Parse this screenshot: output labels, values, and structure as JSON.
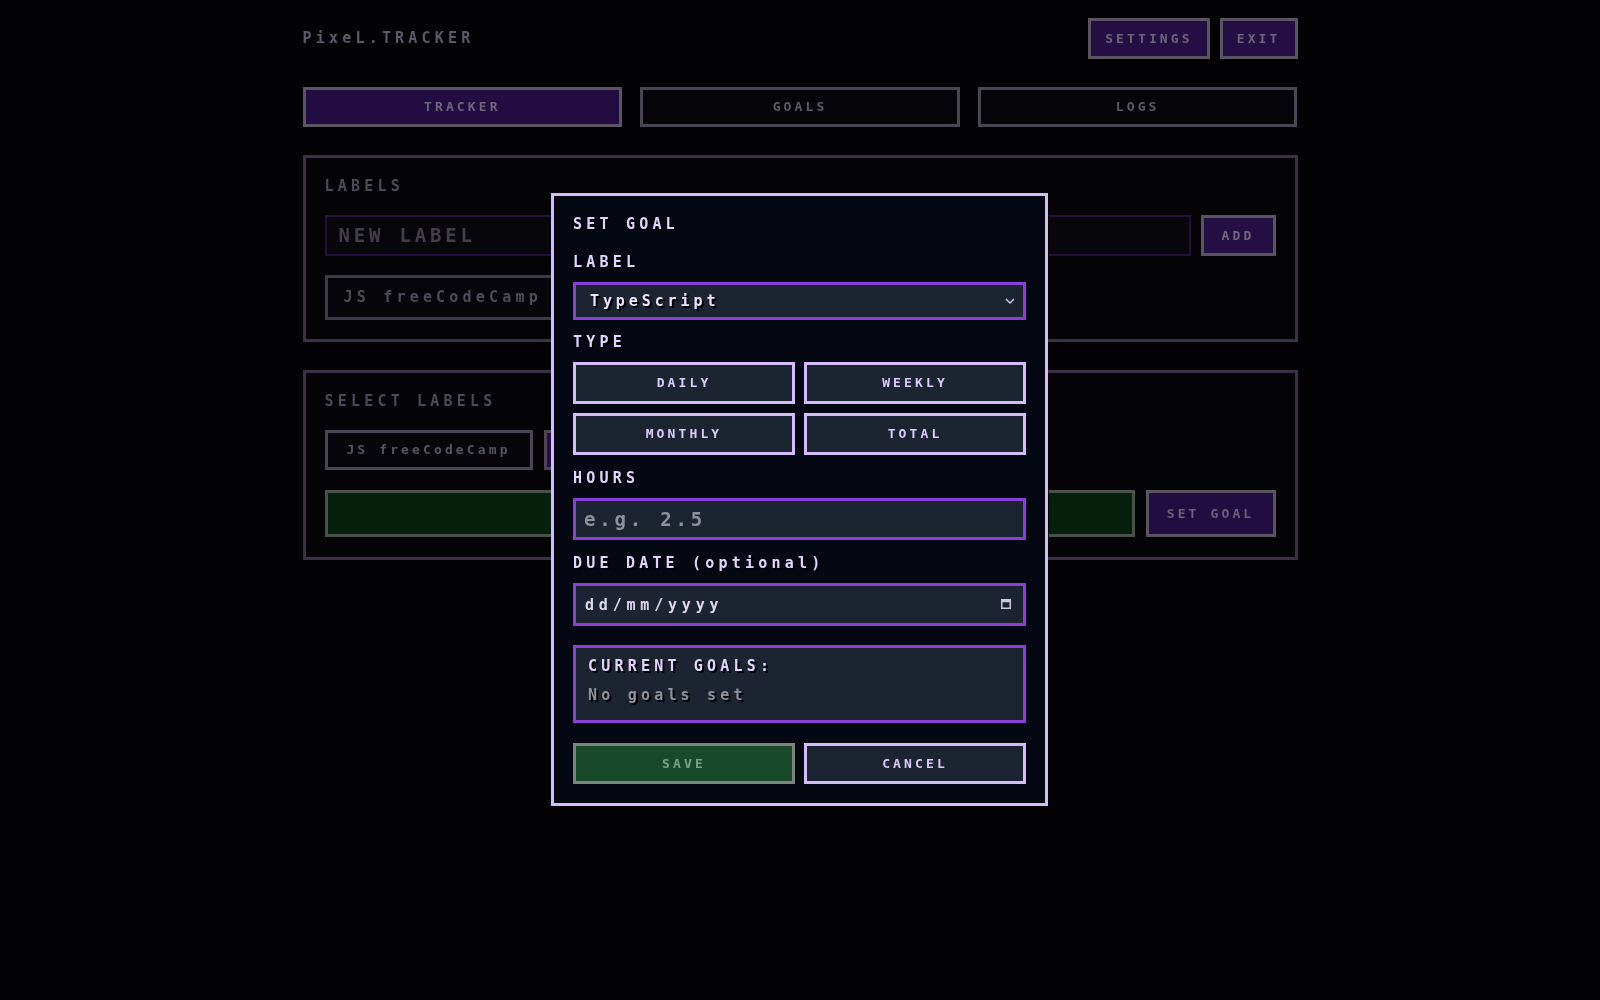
{
  "app": {
    "title": "PixeL.TRACKER",
    "actions": [
      "SETTINGS",
      "EXIT"
    ]
  },
  "tabs": [
    {
      "label": "TRACKER",
      "selected": true
    },
    {
      "label": "GOALS",
      "selected": false
    },
    {
      "label": "LOGS",
      "selected": false
    }
  ],
  "labels_panel": {
    "heading": "LABELS",
    "new_label": {
      "placeholder": "NEW LABEL"
    },
    "add_button": "ADD",
    "labels": [
      {
        "label": "JS freeCodeCamp"
      }
    ]
  },
  "select_panel": {
    "heading": "SELECT LABELS",
    "labels": [
      {
        "label": "JS freeCodeCamp",
        "selected": false
      },
      {
        "selected": true
      }
    ],
    "set_goal_button": "SET GOAL"
  },
  "dialog": {
    "title": "SET GOAL",
    "label_field": {
      "label": "LABEL",
      "value": "TypeScript"
    },
    "type_field": {
      "label": "TYPE",
      "options": [
        {
          "label": "DAILY",
          "selected": false
        },
        {
          "label": "WEEKLY",
          "selected": false
        },
        {
          "label": "MONTHLY",
          "selected": false
        },
        {
          "label": "TOTAL",
          "selected": false
        }
      ]
    },
    "hours_field": {
      "label": "HOURS",
      "placeholder": "e.g. 2.5"
    },
    "due_date_field": {
      "label": "DUE DATE (optional)",
      "placeholder": "dd/mm/yyyy"
    },
    "current_goals": {
      "heading": "CURRENT GOALS:",
      "empty_text": "No goals set"
    },
    "buttons": [
      {
        "label": "SAVE",
        "kind": "save",
        "disabled": true
      },
      {
        "label": "CANCEL",
        "kind": "cancel",
        "disabled": false
      }
    ]
  }
}
